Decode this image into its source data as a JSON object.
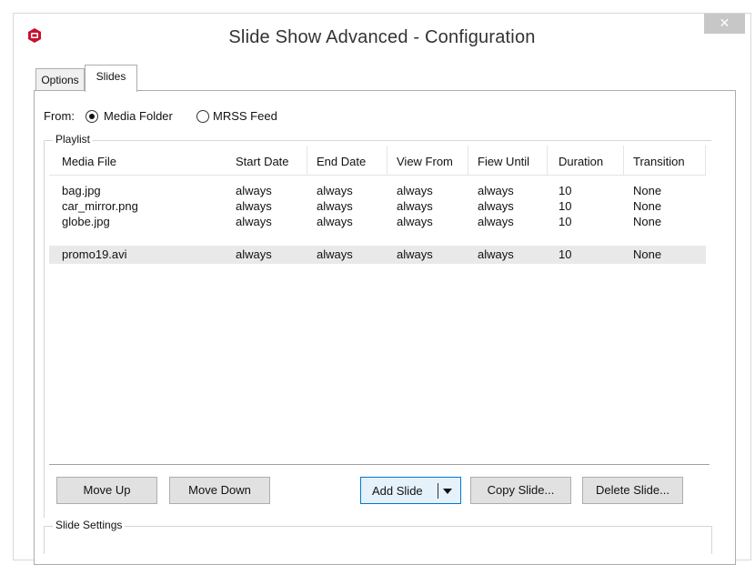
{
  "window": {
    "title": "Slide Show Advanced - Configuration",
    "close_glyph": "✕",
    "accent_color": "#c8102e"
  },
  "tabs": [
    {
      "label": "Options",
      "active": false
    },
    {
      "label": "Slides",
      "active": true
    }
  ],
  "source": {
    "label": "From:",
    "options": [
      {
        "label": "Media Folder",
        "selected": true
      },
      {
        "label": "MRSS Feed",
        "selected": false
      }
    ]
  },
  "playlist": {
    "title": "Playlist",
    "columns": [
      "Media File",
      "Start Date",
      "End Date",
      "View From",
      "Fiew Until",
      "Duration",
      "Transition"
    ],
    "rows": [
      {
        "cells": [
          "bag.jpg",
          "always",
          "always",
          "always",
          "always",
          "10",
          "None"
        ],
        "selected": false
      },
      {
        "cells": [
          "car_mirror.png",
          "always",
          "always",
          "always",
          "always",
          "10",
          "None"
        ],
        "selected": false
      },
      {
        "cells": [
          "globe.jpg",
          "always",
          "always",
          "always",
          "always",
          "10",
          "None"
        ],
        "selected": false
      },
      {
        "cells": [
          "promo19.avi",
          "always",
          "always",
          "always",
          "always",
          "10",
          "None"
        ],
        "selected": true
      }
    ]
  },
  "buttons": {
    "move_up": "Move Up",
    "move_down": "Move Down",
    "add_slide": "Add Slide",
    "copy_slide": "Copy Slide...",
    "delete_slide": "Delete Slide..."
  },
  "slide_settings": {
    "title": "Slide Settings"
  }
}
